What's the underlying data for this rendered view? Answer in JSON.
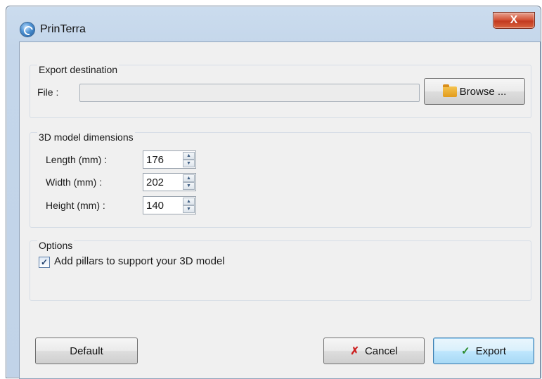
{
  "window": {
    "title": "PrinTerra",
    "close_label": "X"
  },
  "export_destination": {
    "group_title": "Export destination",
    "file_label": "File :",
    "file_value": "",
    "browse_label": "Browse ..."
  },
  "dimensions": {
    "group_title": "3D model dimensions",
    "length_label": "Length (mm) :",
    "length_value": "176",
    "width_label": "Width (mm) :",
    "width_value": "202",
    "height_label": "Height (mm) :",
    "height_value": "140",
    "spin_up": "▲",
    "spin_down": "▼"
  },
  "options": {
    "group_title": "Options",
    "pillars_label": "Add pillars to support your 3D model",
    "pillars_checked": true,
    "check_mark": "✓"
  },
  "footer": {
    "default_label": "Default",
    "cancel_label": "Cancel",
    "cancel_icon": "✗",
    "export_label": "Export",
    "export_icon": "✓"
  },
  "colors": {
    "accent": "#3c7fb1",
    "close_button": "#c23a20"
  }
}
